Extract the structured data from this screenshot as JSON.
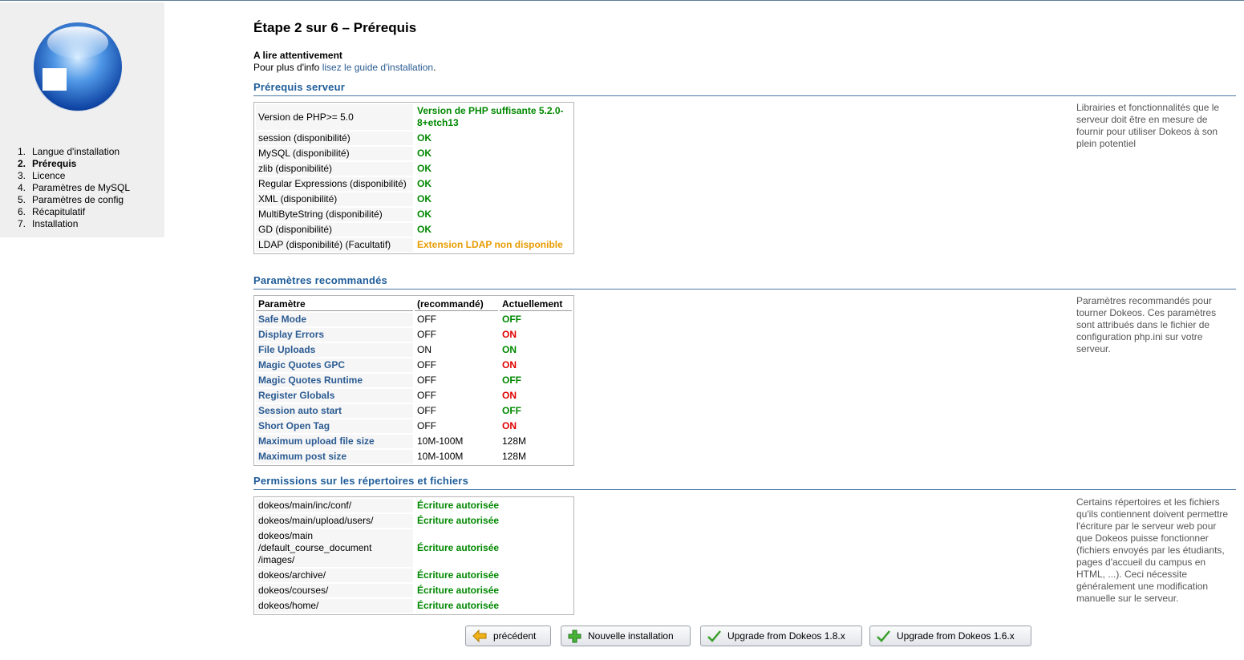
{
  "sidebar": {
    "steps": [
      {
        "num": "1.",
        "label": "Langue d'installation"
      },
      {
        "num": "2.",
        "label": "Prérequis"
      },
      {
        "num": "3.",
        "label": "Licence"
      },
      {
        "num": "4.",
        "label": "Paramètres de MySQL"
      },
      {
        "num": "5.",
        "label": "Paramètres de config"
      },
      {
        "num": "6.",
        "label": "Récapitulatif"
      },
      {
        "num": "7.",
        "label": "Installation"
      }
    ]
  },
  "page": {
    "title": "Étape 2 sur 6 – Prérequis",
    "notice_heading": "A lire attentivement",
    "notice_text": "Pour plus d'info ",
    "notice_link": "lisez le guide d'installation",
    "notice_end": "."
  },
  "server": {
    "heading": "Prérequis serveur",
    "note": "Librairies et fonctionnalités que le serveur doit être en mesure de fournir pour utiliser Dokeos à son plein potentiel",
    "rows": [
      {
        "label": "Version de PHP>= 5.0",
        "value": "Version de PHP suffisante 5.2.0-8+etch13",
        "status": "ok"
      },
      {
        "label": "session (disponibilité)",
        "value": "OK",
        "status": "ok"
      },
      {
        "label": "MySQL (disponibilité)",
        "value": "OK",
        "status": "ok"
      },
      {
        "label": "zlib (disponibilité)",
        "value": "OK",
        "status": "ok"
      },
      {
        "label": "Regular Expressions (disponibilité)",
        "value": "OK",
        "status": "ok"
      },
      {
        "label": "XML (disponibilité)",
        "value": "OK",
        "status": "ok"
      },
      {
        "label": "MultiByteString (disponibilité)",
        "value": "OK",
        "status": "ok"
      },
      {
        "label": "GD (disponibilité)",
        "value": "OK",
        "status": "ok"
      },
      {
        "label": "LDAP (disponibilité) (Facultatif)",
        "value": "Extension LDAP non disponible",
        "status": "warn"
      }
    ]
  },
  "recommended": {
    "heading": "Paramètres recommandés",
    "note": "Paramètres recommandés pour tourner Dokeos. Ces paramètres sont attribués dans le fichier de configuration php.ini sur votre serveur.",
    "headers": [
      "Paramètre",
      "(recommandé)",
      "Actuellement"
    ],
    "rows": [
      {
        "param": "Safe Mode",
        "recommended": "OFF",
        "current": "OFF",
        "status": "ok"
      },
      {
        "param": "Display Errors",
        "recommended": "OFF",
        "current": "ON",
        "status": "bad"
      },
      {
        "param": "File Uploads",
        "recommended": "ON",
        "current": "ON",
        "status": "ok"
      },
      {
        "param": "Magic Quotes GPC",
        "recommended": "OFF",
        "current": "ON",
        "status": "bad"
      },
      {
        "param": "Magic Quotes Runtime",
        "recommended": "OFF",
        "current": "OFF",
        "status": "ok"
      },
      {
        "param": "Register Globals",
        "recommended": "OFF",
        "current": "ON",
        "status": "bad"
      },
      {
        "param": "Session auto start",
        "recommended": "OFF",
        "current": "OFF",
        "status": "ok"
      },
      {
        "param": "Short Open Tag",
        "recommended": "OFF",
        "current": "ON",
        "status": "bad"
      },
      {
        "param": "Maximum upload file size",
        "recommended": "10M-100M",
        "current": "128M",
        "status": "plain"
      },
      {
        "param": "Maximum post size",
        "recommended": "10M-100M",
        "current": "128M",
        "status": "plain"
      }
    ]
  },
  "permissions": {
    "heading": "Permissions sur les répertoires et fichiers",
    "note": "Certains répertoires et les fichiers qu'ils contiennent doivent permettre l'écriture par le serveur web pour que Dokeos puisse fonctionner (fichiers envoyés par les étudiants, pages d'accueil du campus en HTML, ...). Ceci nécessite généralement une modification manuelle sur le serveur.",
    "rows": [
      {
        "path": "dokeos/main/inc/conf/",
        "value": "Écriture autorisée"
      },
      {
        "path": "dokeos/main/upload/users/",
        "value": "Écriture autorisée"
      },
      {
        "path": "dokeos/main /default_course_document /images/",
        "value": "Écriture autorisée"
      },
      {
        "path": "dokeos/archive/",
        "value": "Écriture autorisée"
      },
      {
        "path": "dokeos/courses/",
        "value": "Écriture autorisée"
      },
      {
        "path": "dokeos/home/",
        "value": "Écriture autorisée"
      }
    ]
  },
  "buttons": {
    "previous": "précédent",
    "new_install": "Nouvelle installation",
    "upgrade_18": "Upgrade from Dokeos 1.8.x",
    "upgrade_16": "Upgrade from Dokeos 1.6.x"
  },
  "colors": {
    "ok": "#008800",
    "warn": "#e89b00",
    "bad": "#e00000",
    "link": "#2b5b92",
    "heading": "#1f5d9a"
  }
}
